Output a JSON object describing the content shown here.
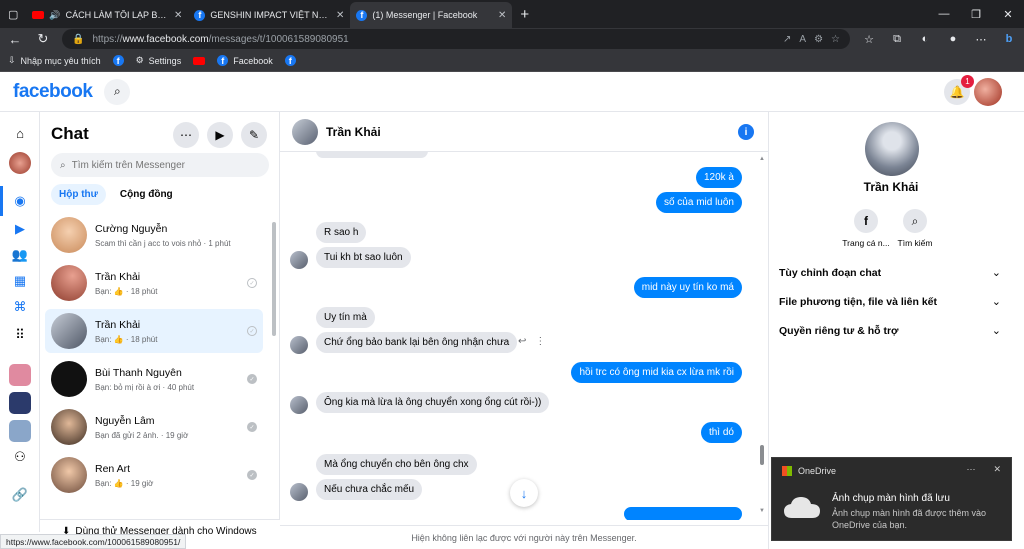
{
  "browser": {
    "tabs": [
      {
        "title": "CÁCH LÀM TÔI LẠP BÁT - N",
        "icon": "youtube-icon",
        "active": false
      },
      {
        "title": "GENSHIN IMPACT VIỆT NAM TRA",
        "icon": "facebook-icon",
        "active": false
      },
      {
        "title": "(1) Messenger | Facebook",
        "icon": "facebook-icon",
        "active": true
      }
    ],
    "url_prefix": "https://",
    "url_host": "www.facebook.com",
    "url_path": "/messages/t/100061589080951",
    "bookmarks": [
      {
        "label": "Nhập mục yêu thích",
        "icon": "import-icon"
      },
      {
        "label": "",
        "icon": "facebook-icon"
      },
      {
        "label": "Settings",
        "icon": "gear-icon"
      },
      {
        "label": "",
        "icon": "youtube-icon"
      },
      {
        "label": "Facebook",
        "icon": "facebook-icon"
      },
      {
        "label": "",
        "icon": "facebook-icon"
      }
    ],
    "status_url": "https://www.facebook.com/100061589080951/"
  },
  "header": {
    "logo": "facebook",
    "notification_count": "1"
  },
  "chatlist": {
    "title": "Chat",
    "search_placeholder": "Tìm kiếm trên Messenger",
    "tabs": [
      "Hộp thư",
      "Cộng đồng"
    ],
    "conversations": [
      {
        "name": "Cường Nguyễn",
        "snippet": "Scam thì cần j acc to vois nhỏ · 1 phút",
        "seen": "none"
      },
      {
        "name": "Trần Khải",
        "snippet": "Bạn: 👍 · 18 phút",
        "seen": "outline"
      },
      {
        "name": "Trần Khải",
        "snippet": "Bạn: 👍 · 18 phút",
        "seen": "outline"
      },
      {
        "name": "Bùi Thanh Nguyên",
        "snippet": "Bạn: bỏ mị rồi à ơi · 40 phút",
        "seen": "filled"
      },
      {
        "name": "Nguyễn Lâm",
        "snippet": "Bạn đã gửi 2 ảnh. · 19 giờ",
        "seen": "filled"
      },
      {
        "name": "Ren Art",
        "snippet": "Bạn: 👍 · 19 giờ",
        "seen": "filled"
      }
    ],
    "footer": "Dùng thử Messenger dành cho Windows"
  },
  "conversation": {
    "name": "Trần Khải",
    "footer": "Hiện không liên lạc được với người này trên Messenger.",
    "messages": [
      {
        "dir": "out",
        "text": "120k à"
      },
      {
        "dir": "out",
        "text": "số của mid luôn"
      },
      {
        "dir": "in",
        "text": "R sao h"
      },
      {
        "dir": "in",
        "text": "Tui kh bt sao luôn"
      },
      {
        "dir": "out",
        "text": "mid này uy tín ko má"
      },
      {
        "dir": "in",
        "text": "Uy tín mà"
      },
      {
        "dir": "in",
        "text": "Chứ ổng bảo bank lại bên ông nhận chưa"
      },
      {
        "dir": "out",
        "text": "hồi trc có ông mid kia cx lừa mk rồi"
      },
      {
        "dir": "in",
        "text": "Ông kia mà lừa là ông chuyển xong ổng cút rồi-))"
      },
      {
        "dir": "out",
        "text": "thì dó"
      },
      {
        "dir": "in",
        "text": "Mà ổng chuyển cho bên ông chx"
      },
      {
        "dir": "in",
        "text": "Nếu chưa chắc mếu"
      }
    ]
  },
  "info_panel": {
    "name": "Trần Khải",
    "actions": [
      "Trang cá n...",
      "Tìm kiếm"
    ],
    "sections": [
      "Tùy chỉnh đoạn chat",
      "File phương tiện, file và liên kết",
      "Quyền riêng tư & hỗ trợ"
    ]
  },
  "toast": {
    "app": "OneDrive",
    "title": "Ảnh chụp màn hình đã lưu",
    "body": "Ảnh chụp màn hình đã được thêm vào OneDrive của bạn."
  },
  "colors": {
    "fb_blue": "#1877f2",
    "out_bubble": "#0084ff",
    "in_bubble": "#e4e6eb",
    "chrome_dark": "#35363a"
  }
}
